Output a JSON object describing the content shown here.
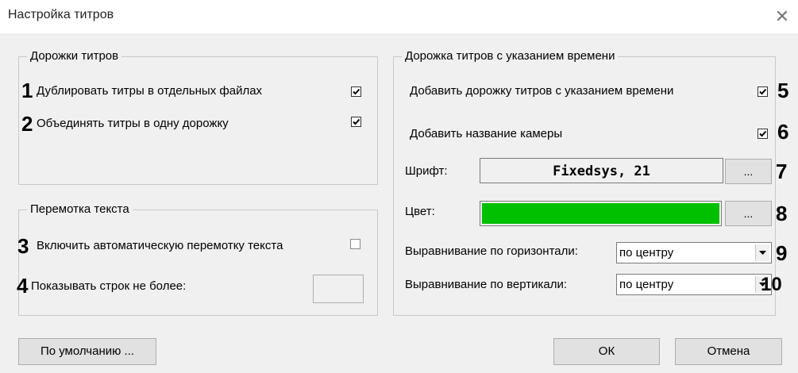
{
  "window": {
    "title": "Настройка титров",
    "close_glyph": "✕"
  },
  "tracks_group": {
    "legend": "Дорожки титров",
    "items": [
      {
        "num": "1",
        "label": "Дублировать титры в отдельных файлах",
        "checked": true
      },
      {
        "num": "2",
        "label": "Объединять титры в одну дорожку",
        "checked": true
      }
    ]
  },
  "scroll_group": {
    "legend": "Перемотка текста",
    "auto_scroll": {
      "num": "3",
      "label": "Включить автоматическую перемотку текста",
      "checked": false
    },
    "max_lines": {
      "num": "4",
      "label": "Показывать строк не более:",
      "value": ""
    }
  },
  "time_group": {
    "legend": "Дорожка титров с указанием времени",
    "add_track": {
      "label": "Добавить дорожку титров с указанием времени",
      "checked": true,
      "num": "5"
    },
    "add_camera": {
      "label": "Добавить название камеры",
      "checked": true,
      "num": "6"
    },
    "font": {
      "label": "Шрифт:",
      "value": "Fixedsys, 21",
      "button": "...",
      "num": "7"
    },
    "color": {
      "label": "Цвет:",
      "value": "#00c000",
      "button": "...",
      "num": "8"
    },
    "h_align": {
      "label": "Выравнивание по горизонтали:",
      "value": "по центру",
      "num": "9"
    },
    "v_align": {
      "label": "Выравнивание по вертикали:",
      "value": "по центру",
      "num": "10"
    }
  },
  "buttons": {
    "defaults": "По умолчанию ...",
    "ok": "ОК",
    "cancel": "Отмена"
  },
  "icons": {
    "checkbox_check": "check-icon",
    "dropdown_arrow": "dropdown-arrow-icon",
    "close": "close-icon"
  }
}
